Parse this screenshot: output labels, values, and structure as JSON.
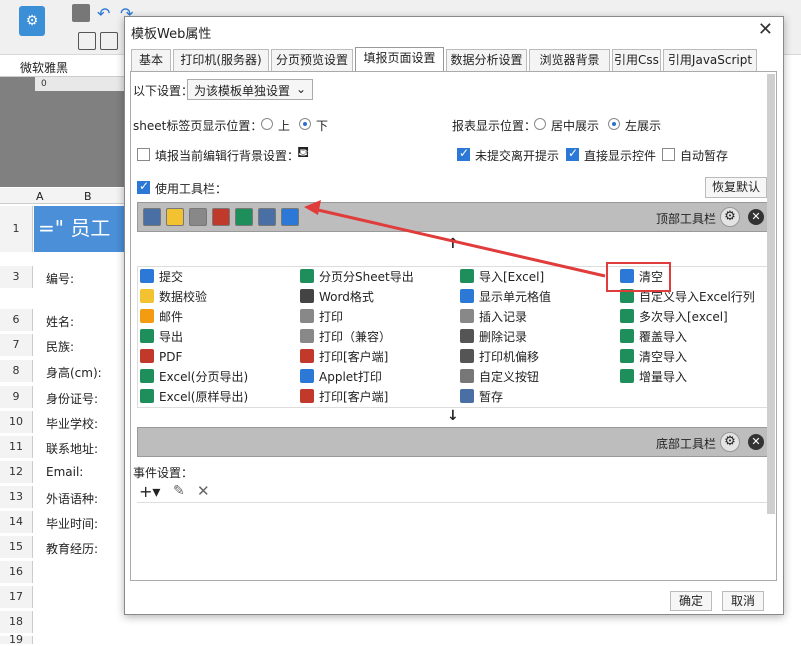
{
  "app": {
    "font_name": "微软雅黑",
    "ruler_zero": "0",
    "columns": [
      "A",
      "B"
    ],
    "row1_text": "=\"  员工"
  },
  "sheet_rows": [
    {
      "num": "1"
    },
    {
      "num": "3",
      "label": "编号:"
    },
    {
      "num": "6",
      "label": "姓名:"
    },
    {
      "num": "7",
      "label": "民族:"
    },
    {
      "num": "8",
      "label": "身高(cm):"
    },
    {
      "num": "9",
      "label": "身份证号:"
    },
    {
      "num": "10",
      "label": "毕业学校:"
    },
    {
      "num": "11",
      "label": "联系地址:"
    },
    {
      "num": "12",
      "label": "Email:"
    },
    {
      "num": "13",
      "label": "外语语种:"
    },
    {
      "num": "14",
      "label": "毕业时间:"
    },
    {
      "num": "15",
      "label": "教育经历:"
    },
    {
      "num": "16"
    },
    {
      "num": "17"
    },
    {
      "num": "18"
    },
    {
      "num": "19"
    }
  ],
  "dialog": {
    "title": "模板Web属性",
    "close": "✕",
    "tabs": [
      "基本",
      "打印机(服务器)",
      "分页预览设置",
      "填报页面设置",
      "数据分析设置",
      "浏览器背景",
      "引用Css",
      "引用JavaScript"
    ],
    "settings_for_label": "以下设置：",
    "settings_for_value": "为该模板单独设置",
    "sheet_pos_label": "sheet标签页显示位置：",
    "sheet_pos_options": [
      "上",
      "下"
    ],
    "report_pos_label": "报表显示位置：",
    "report_pos_options": [
      "居中展示",
      "左展示"
    ],
    "fill_bg_label": "填报当前编辑行背景设置：",
    "unsaved_label": "未提交离开提示",
    "direct_label": "直接显示控件",
    "autosave_label": "自动暂存",
    "use_toolbar_label": "使用工具栏：",
    "restore_default": "恢复默认",
    "top_toolbar_label": "顶部工具栏",
    "bottom_toolbar_label": "底部工具栏",
    "up_arrow": "↑",
    "down_arrow": "↓",
    "events_label": "事件设置：",
    "ok": "确定",
    "cancel": "取消",
    "items": [
      [
        "提交",
        "分页分Sheet导出",
        "导入[Excel]",
        "清空"
      ],
      [
        "数据校验",
        "Word格式",
        "显示单元格值",
        "自定义导入Excel行列"
      ],
      [
        "邮件",
        "打印",
        "插入记录",
        "多次导入[excel]"
      ],
      [
        "导出",
        "打印（兼容）",
        "删除记录",
        "覆盖导入"
      ],
      [
        "PDF",
        "打印[客户端]",
        "打印机偏移",
        "清空导入"
      ],
      [
        "Excel(分页导出)",
        "Applet打印",
        "自定义按钮",
        "增量导入"
      ],
      [
        "Excel(原样导出)",
        "打印[客户端]",
        "暂存",
        ""
      ]
    ]
  },
  "colors": {
    "accent": "#2b78d6",
    "highlight": "#e03c3c",
    "bar": "#bdbdbd"
  }
}
